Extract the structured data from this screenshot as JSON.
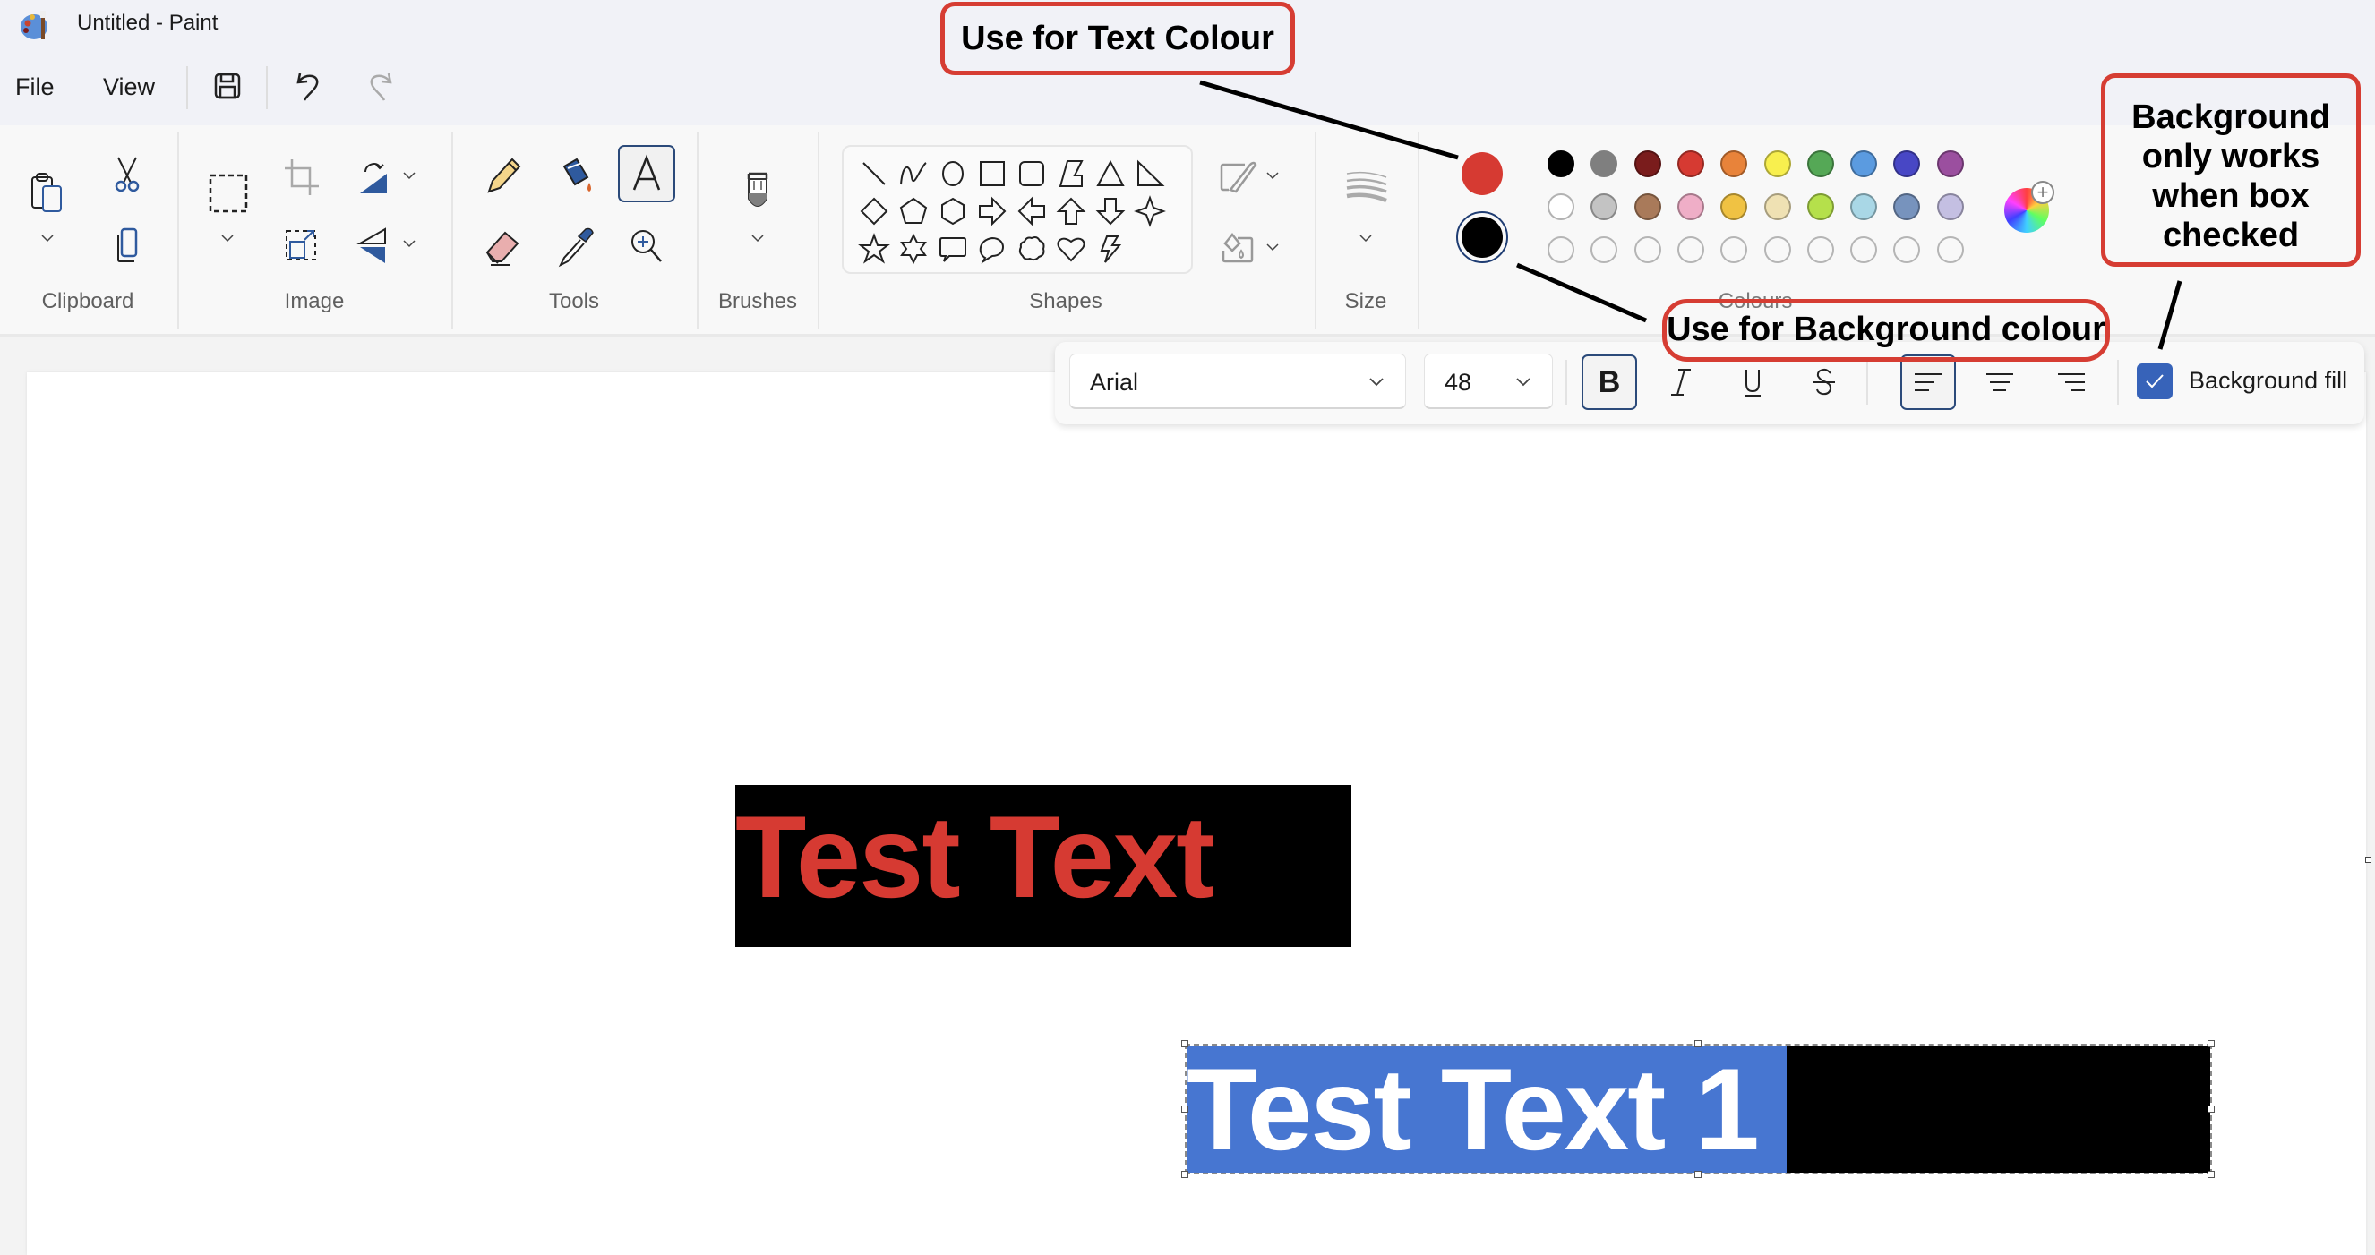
{
  "window": {
    "title": "Untitled - Paint"
  },
  "menu": {
    "file": "File",
    "view": "View"
  },
  "quick_actions": {
    "save": "save-icon",
    "undo": "undo-icon",
    "redo": "redo-icon"
  },
  "ribbon": {
    "groups": {
      "clipboard": "Clipboard",
      "image": "Image",
      "tools": "Tools",
      "brushes": "Brushes",
      "shapes": "Shapes",
      "size": "Size",
      "colours": "Colours"
    },
    "selected_tool": "text",
    "colour_primary": "#d63a32",
    "colour_secondary": "#000000",
    "palette_row1": [
      "#000000",
      "#7f7f7f",
      "#7a1c1c",
      "#d63a32",
      "#e8833a",
      "#f8ef4e",
      "#55a856",
      "#5b9be0",
      "#4847c5",
      "#9b4f9f"
    ],
    "palette_row2": [
      "#ffffff",
      "#c3c3c3",
      "#a97a5a",
      "#efaec7",
      "#f0c243",
      "#efe1b3",
      "#b5e04b",
      "#a9d7e6",
      "#7793bd",
      "#c4bfe2"
    ],
    "palette_row3": [
      "",
      "",
      "",
      "",
      "",
      "",
      "",
      "",
      "",
      ""
    ]
  },
  "text_toolbar": {
    "font": "Arial",
    "size": "48",
    "bold": true,
    "italic": false,
    "underline": false,
    "strikethrough": false,
    "align": "left",
    "background_fill_checked": true,
    "background_fill_label": "Background fill"
  },
  "canvas": {
    "text1": {
      "text": "Test Text",
      "color": "#d63a32",
      "background": "#000000"
    },
    "text2": {
      "text": "Test Text 1",
      "color": "#ffffff",
      "highlight": "#4776d1",
      "background": "#000000"
    }
  },
  "annotations": {
    "text_colour": "Use for Text Colour",
    "background_colour": "Use for Background colour",
    "background_note": [
      "Background",
      "only works",
      "when box",
      "checked"
    ]
  }
}
